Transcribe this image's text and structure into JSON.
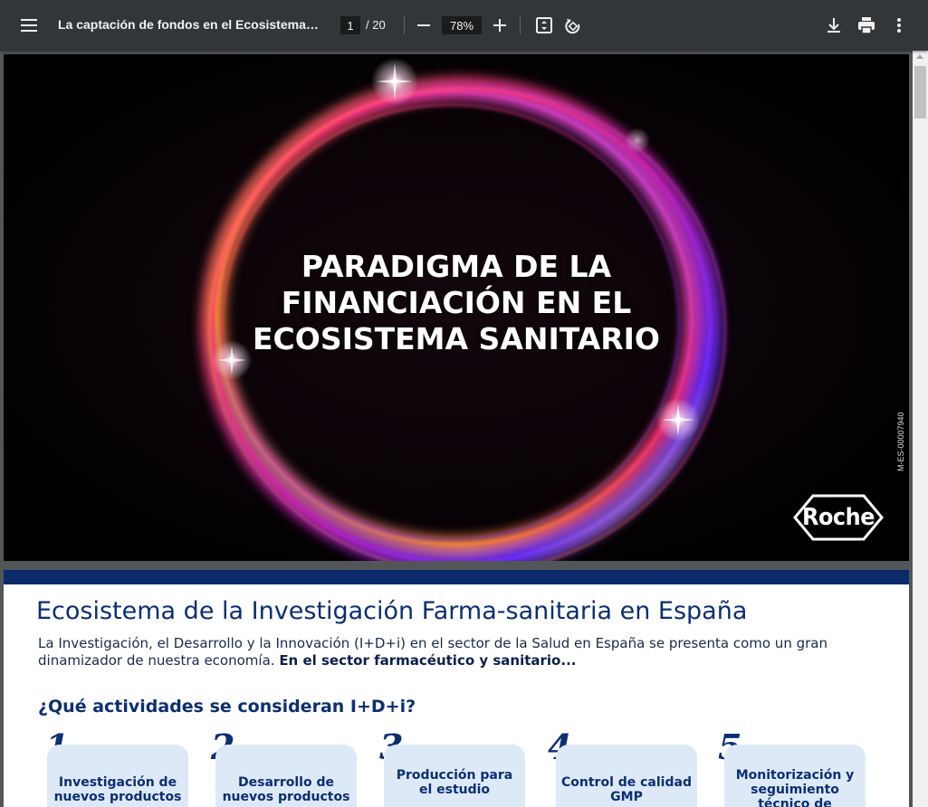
{
  "toolbar": {
    "title": "La captación de fondos en el Ecosistema Sa...",
    "page_current": "1",
    "page_total": "/ 20",
    "zoom": "78%",
    "icons": [
      "menu-icon",
      "zoom-out-icon",
      "zoom-in-icon",
      "fit-page-icon",
      "rotate-icon",
      "download-icon",
      "print-icon",
      "more-vert-icon"
    ]
  },
  "cover": {
    "title_lines": [
      "PARADIGMA DE LA",
      "FINANCIACIÓN EN EL",
      "ECOSISTEMA SANITARIO"
    ],
    "doc_code": "M-ES-00007940",
    "logo_text": "Roche"
  },
  "page2": {
    "heading": "Ecosistema de la Investigación Farma-sanitaria en España",
    "intro": "La Investigación, el Desarrollo y la Innovación (I+D+i) en el sector de la Salud en España se presenta como un gran dinamizador de nuestra economía.",
    "intro_bold": "En el sector farmacéutico y sanitario...",
    "question": "¿Qué actividades se consideran I+D+i?",
    "activities": [
      {
        "number": "1",
        "label": "Investigación de nuevos productos"
      },
      {
        "number": "2",
        "label": "Desarrollo de nuevos productos"
      },
      {
        "number": "3",
        "label": "Producción para el estudio"
      },
      {
        "number": "4",
        "label": "Control de calidad GMP"
      },
      {
        "number": "5",
        "label": "Monitorización y seguimiento técnico de ensayos clínicos"
      }
    ]
  },
  "colors": {
    "toolbar_bg": "#323639",
    "viewer_bg": "#525659",
    "brand_navy": "#0b2f72",
    "card_bg": "#dde9f7"
  }
}
